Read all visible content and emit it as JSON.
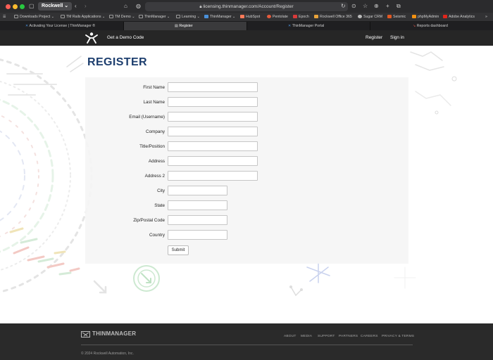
{
  "browser": {
    "profile_label": "Rockwell",
    "url": "licensing.thinmanager.com/Account/Register",
    "bookmarks": [
      {
        "label": "Downloads Project",
        "icon": "folder-icon",
        "color": "#9a9a9a"
      },
      {
        "label": "TM Rails Applications",
        "icon": "folder-icon",
        "color": "#9a9a9a"
      },
      {
        "label": "TM Demo",
        "icon": "folder-icon",
        "color": "#9a9a9a"
      },
      {
        "label": "ThinManager",
        "icon": "folder-icon",
        "color": "#9a9a9a"
      },
      {
        "label": "Learning",
        "icon": "folder-icon",
        "color": "#9a9a9a"
      },
      {
        "label": "ThinManager",
        "icon": "thinmanager-icon",
        "color": "#4a90d9"
      },
      {
        "label": "HubSpot",
        "icon": "hubspot-icon",
        "color": "#ff7a59"
      },
      {
        "label": "Pentolate",
        "icon": "pentolate-icon",
        "color": "#e55b3c"
      },
      {
        "label": "Epoch",
        "icon": "epoch-icon",
        "color": "#d93a3a"
      },
      {
        "label": "Rockwell Office 365",
        "icon": "office-icon",
        "color": "#e8a33b"
      },
      {
        "label": "Sugar CRM",
        "icon": "sugar-icon",
        "color": "#bbbbbb"
      },
      {
        "label": "Seismic",
        "icon": "seismic-icon",
        "color": "#e25822"
      },
      {
        "label": "phpMyAdmin",
        "icon": "phpmyadmin-icon",
        "color": "#f29111"
      },
      {
        "label": "Adobe Analytics",
        "icon": "adobe-icon",
        "color": "#e1251b"
      }
    ],
    "tabs": [
      {
        "label": "Activating Your License | ThinManager ®",
        "active": false
      },
      {
        "label": "Register",
        "active": true
      },
      {
        "label": "ThinManager Portal",
        "active": false
      },
      {
        "label": "Reports dashboard",
        "active": false
      }
    ]
  },
  "header": {
    "demo_link": "Get a Demo Code",
    "register_link": "Register",
    "signin_link": "Sign in"
  },
  "page": {
    "title": "REGISTER"
  },
  "form": {
    "fields": [
      {
        "label": "First Name",
        "value": ""
      },
      {
        "label": "Last Name",
        "value": ""
      },
      {
        "label": "Email (Username)",
        "value": ""
      },
      {
        "label": "Company",
        "value": ""
      },
      {
        "label": "Title/Position",
        "value": ""
      },
      {
        "label": "Address",
        "value": ""
      },
      {
        "label": "Address 2",
        "value": ""
      },
      {
        "label": "City",
        "value": ""
      },
      {
        "label": "State",
        "value": ""
      },
      {
        "label": "Zip/Postal Code",
        "value": ""
      },
      {
        "label": "Country",
        "value": ""
      }
    ],
    "submit_label": "Submit"
  },
  "footer": {
    "brand": "THINMANAGER",
    "links": [
      "ABOUT",
      "MEDIA",
      "SUPPORT",
      "PARTNERS",
      "CAREERS",
      "PRIVACY & TERMS"
    ],
    "copyright": "© 2024 Rockwell Automation, Inc."
  },
  "colors": {
    "title": "#1d3e6e",
    "header_bg": "#262626",
    "footer_bg": "#2a2a2a",
    "deco_green": "#5cbf6a",
    "deco_red": "#e05a4e",
    "deco_blue": "#6a82c9"
  }
}
